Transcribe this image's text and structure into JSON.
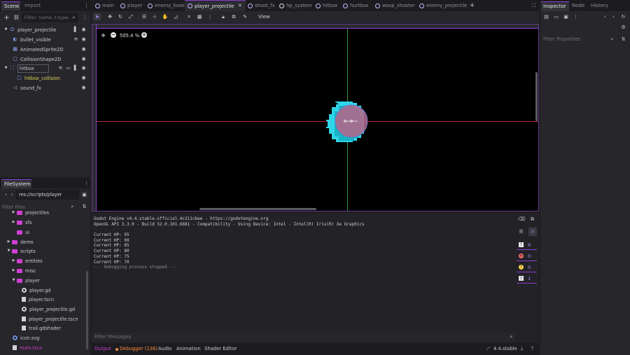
{
  "scene_dock": {
    "tabs": [
      "Scene",
      "Import"
    ],
    "filter_placeholder": "Filter: name, t:type,",
    "nodes": [
      {
        "label": "player_projectile",
        "icon": "node2d-icon"
      },
      {
        "label": "bullet_visible",
        "icon": "notifier-icon"
      },
      {
        "label": "AnimatedSprite2D",
        "icon": "animated-sprite-icon"
      },
      {
        "label": "CollisionShape2D",
        "icon": "collision-shape-icon"
      },
      {
        "label": "hitbox",
        "icon": "area2d-icon"
      },
      {
        "label": "hitbox_collision",
        "icon": "collision-shape-icon"
      },
      {
        "label": "sound_fx",
        "icon": "audio-icon"
      }
    ]
  },
  "filesystem": {
    "title": "FileSystem",
    "path": "res://scripts/player",
    "filter_placeholder": "Filter Files",
    "items": [
      {
        "label": "projectiles",
        "type": "folder"
      },
      {
        "label": "sfx",
        "type": "folder"
      },
      {
        "label": "ui",
        "type": "folder"
      },
      {
        "label": "demo",
        "type": "folder"
      },
      {
        "label": "scripts",
        "type": "folder"
      },
      {
        "label": "entities",
        "type": "folder"
      },
      {
        "label": "misc",
        "type": "folder"
      },
      {
        "label": "player",
        "type": "folder"
      },
      {
        "label": "player.gd",
        "type": "script"
      },
      {
        "label": "player.tscn",
        "type": "scene"
      },
      {
        "label": "player_projectile.gd",
        "type": "script"
      },
      {
        "label": "player_projectile.tscn",
        "type": "scene"
      },
      {
        "label": "trail.gdshader",
        "type": "shader"
      },
      {
        "label": "icon.svg",
        "type": "image"
      },
      {
        "label": "main.tscn",
        "type": "scene"
      }
    ]
  },
  "editor_tabs": [
    "main",
    "player",
    "enemy_base",
    "player_projectile",
    "shoot_fx",
    "hp_system",
    "hitbox",
    "hurtbox",
    "wasp_shooter",
    "enemy_projectile"
  ],
  "active_tab": "player_projectile",
  "toolbar": {
    "view_label": "View"
  },
  "viewport": {
    "zoom": "505.4 %"
  },
  "output": {
    "lines": [
      "Godot Engine v4.4.stable.official.4c311cbee - https://godotengine.org",
      "OpenGL API 3.3.0 - Build 32.0.101.6881 - Compatibility - Using Device: Intel - Intel(R) Iris(R) Xe Graphics",
      "",
      "Current HP: 95",
      "Current HP: 90",
      "Current HP: 85",
      "Current HP: 80",
      "Current HP: 75",
      "Current HP: 70",
      "--- Debugging process stopped ---"
    ],
    "filter_placeholder": "Filter Messages",
    "counts": {
      "messages": "9",
      "errors": "0",
      "warnings": "0",
      "info": "1"
    }
  },
  "bottom_tabs": {
    "output": "Output",
    "debugger": "Debugger (136)",
    "audio": "Audio",
    "animation": "Animation",
    "shader_editor": "Shader Editor"
  },
  "version": "4.4.stable",
  "inspector": {
    "tabs": [
      "Inspector",
      "Node",
      "History"
    ],
    "filter_placeholder": "Filter Properties"
  },
  "colors": {
    "accent": "#8e3bd1",
    "folder": "#d03fd3",
    "selected_node_text": "#e2d45a",
    "sprite_cyan": "#2fd6e8",
    "hitbox_fill": "#b3678a"
  }
}
